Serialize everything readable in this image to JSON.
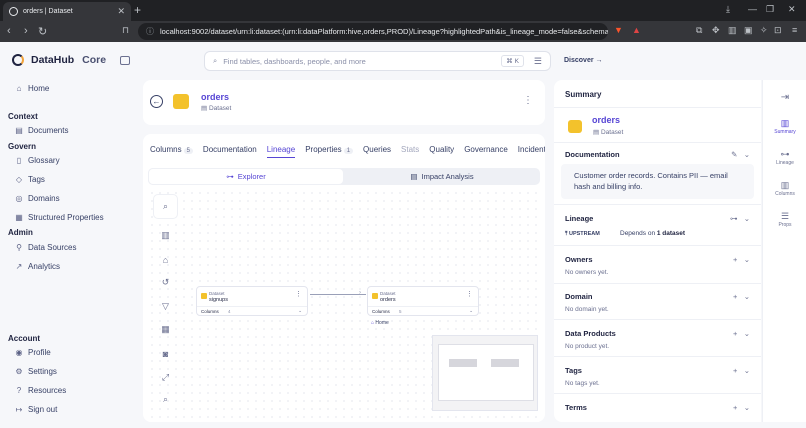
{
  "browser": {
    "tab_title": "orders | Dataset",
    "url": "localhost:9002/dataset/urn:li:dataset:(urn:li:dataPlatform:hive,orders,PROD)/Lineage?highlightedPath&is_lineage_mode=false&schemaF..."
  },
  "app": {
    "brand": "DataHub",
    "edition": "Core",
    "search_placeholder": "Find tables, dashboards, people, and more",
    "search_shortcut": "⌘ K",
    "discover_label": "Discover"
  },
  "sidebar": {
    "home": "Home",
    "context_label": "Context",
    "documents": "Documents",
    "govern_label": "Govern",
    "glossary": "Glossary",
    "tags": "Tags",
    "domains": "Domains",
    "structured_properties": "Structured Properties",
    "admin_label": "Admin",
    "data_sources": "Data Sources",
    "analytics": "Analytics",
    "account_label": "Account",
    "profile": "Profile",
    "settings": "Settings",
    "resources": "Resources",
    "sign_out": "Sign out"
  },
  "entity": {
    "name": "orders",
    "type": "Dataset"
  },
  "tabs": {
    "columns": "Columns",
    "columns_count": "5",
    "documentation": "Documentation",
    "lineage": "Lineage",
    "properties": "Properties",
    "properties_count": "1",
    "queries": "Queries",
    "stats": "Stats",
    "quality": "Quality",
    "governance": "Governance",
    "incidents": "Incidents"
  },
  "lineage": {
    "explorer": "Explorer",
    "impact_analysis": "Impact Analysis",
    "home_badge": "Home",
    "upstream_node": {
      "type": "Dataset",
      "name": "signups",
      "columns_label": "Columns",
      "columns_count": "4"
    },
    "center_node": {
      "type": "Dataset",
      "name": "orders",
      "columns_label": "Columns",
      "columns_count": "5"
    }
  },
  "summary": {
    "title": "Summary",
    "entity_name": "orders",
    "entity_type": "Dataset",
    "documentation_label": "Documentation",
    "documentation_text": "Customer order records. Contains PII — email hash and billing info.",
    "lineage_label": "Lineage",
    "upstream_tag": "UPSTREAM",
    "depends_prefix": "Depends on",
    "depends_value": "1 dataset",
    "owners_label": "Owners",
    "owners_empty": "No owners yet.",
    "domain_label": "Domain",
    "domain_empty": "No domain yet.",
    "data_products_label": "Data Products",
    "data_products_empty": "No product yet.",
    "tags_label": "Tags",
    "tags_empty": "No tags yet.",
    "terms_label": "Terms"
  },
  "rail": {
    "summary": "Summary",
    "lineage": "Lineage",
    "columns": "Columns",
    "props": "Props"
  }
}
